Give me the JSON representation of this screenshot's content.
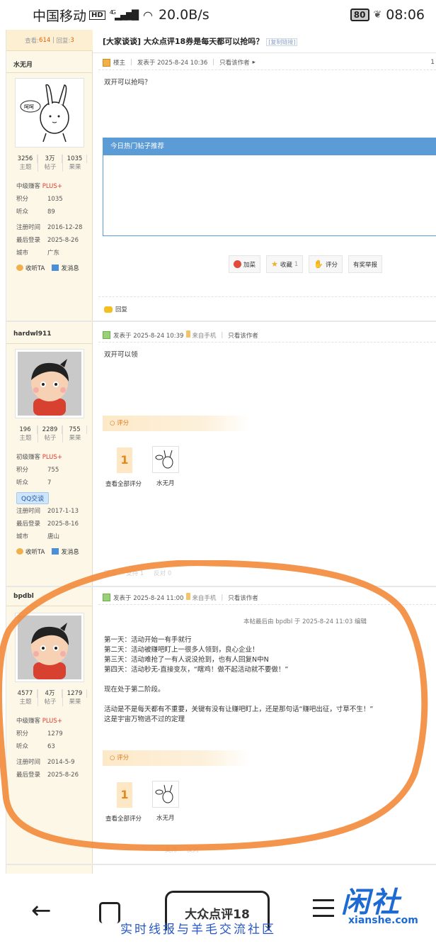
{
  "status_bar": {
    "carrier": "中国移动",
    "hd": "HD",
    "network": "4G",
    "speed": "20.0B/s",
    "battery": "80",
    "time": "08:06"
  },
  "thread": {
    "views_label": "查看:",
    "views": "614",
    "replies_label": "回复:",
    "replies": "3",
    "title": "[大家谈谈] 大众点评18券是每天都可以抢吗？",
    "copy_link": "[复制链接]",
    "page_marker": "1"
  },
  "posts": [
    {
      "username": "水无月",
      "stats": [
        {
          "value": "3256",
          "label": "主题"
        },
        {
          "value": "3万",
          "label": "帖子"
        },
        {
          "value": "1035",
          "label": "果果"
        }
      ],
      "level": "中级赚客",
      "level_plus": "PLUS+",
      "profile": [
        {
          "k": "积分",
          "v": "1035"
        },
        {
          "k": "听众",
          "v": "89"
        },
        {
          "k": "注册时间",
          "v": "2016-12-28"
        },
        {
          "k": "最后登录",
          "v": "2025-8-26"
        },
        {
          "k": "城市",
          "v": "广东"
        }
      ],
      "follow": "收听TA",
      "message": "发消息",
      "badge": "楼主",
      "posted": "发表于 2025-8-24 10:36",
      "only_author": "只看该作者",
      "content": "双开可以抢吗？",
      "hot_title": "今日热门帖子推荐",
      "buttons": [
        "加菜",
        "收藏",
        "评分",
        "有奖举报"
      ],
      "collect_count": "1",
      "reply": "回复"
    },
    {
      "username": "hardwl911",
      "stats": [
        {
          "value": "196",
          "label": "主题"
        },
        {
          "value": "2289",
          "label": "帖子"
        },
        {
          "value": "755",
          "label": "果果"
        }
      ],
      "level": "初级赚客",
      "level_plus": "PLUS+",
      "profile": [
        {
          "k": "积分",
          "v": "755"
        },
        {
          "k": "听众",
          "v": "7"
        }
      ],
      "qq": "QQ交谈",
      "profile2": [
        {
          "k": "注册时间",
          "v": "2017-1-13"
        },
        {
          "k": "最后登录",
          "v": "2025-8-16"
        },
        {
          "k": "城市",
          "v": "唐山"
        }
      ],
      "follow": "收听TA",
      "message": "发消息",
      "posted": "发表于 2025-8-24 10:39",
      "from_mobile": "来自手机",
      "only_author": "只看该作者",
      "content": "双开可以领",
      "rating_label": "评分",
      "rating_count": "1",
      "view_all": "查看全部评分",
      "rater": "水无月",
      "footer": [
        "回复",
        "支持 1",
        "反对 0"
      ]
    },
    {
      "username": "bpdbl",
      "stats": [
        {
          "value": "4577",
          "label": "主题"
        },
        {
          "value": "4万",
          "label": "帖子"
        },
        {
          "value": "1279",
          "label": "果果"
        }
      ],
      "level": "中级赚客",
      "level_plus": "PLUS+",
      "profile": [
        {
          "k": "积分",
          "v": "1279"
        },
        {
          "k": "听众",
          "v": "63"
        },
        {
          "k": "注册时间",
          "v": "2014-5-9"
        },
        {
          "k": "最后登录",
          "v": "2025-8-26"
        }
      ],
      "posted": "发表于 2025-8-24 11:00",
      "from_mobile": "来自手机",
      "only_author": "只看该作者",
      "edit_note": "本帖最后由 bpdbl 于 2025-8-24 11:03 编辑",
      "content": "第一天：活动开始一有手就行\n第二天：活动被赚吧盯上一很多人领到，良心企业！\n第三天：活动难抢了一有人说没抢到，也有人回复N中N\n第四天：活动秒无-直接变灰，“瞎鸡！做不起活动就不要做！”\n\n现在处于第二阶段。\n\n活动是不是每天都有不重要，关键有没有让赚吧盯上，还是那句话“赚吧出征，寸草不生！”\n这是宇宙万物逃不过的定理",
      "rating_label": "评分",
      "rating_count": "1",
      "view_all": "查看全部评分",
      "rater": "水无月",
      "footer": [
        "支持",
        "反对"
      ]
    }
  ],
  "bottom_nav": {
    "tab_title": "大众点评18",
    "brand": "闲社",
    "brand_url": "xianshe.com",
    "slogan": "实时线报与羊毛交流社区"
  },
  "colors": {
    "accent_blue": "#5b9bd6",
    "sidebar_bg": "#fdf7e8",
    "annotation_orange": "#f28a3a",
    "brand_blue": "#1d6ad3"
  }
}
